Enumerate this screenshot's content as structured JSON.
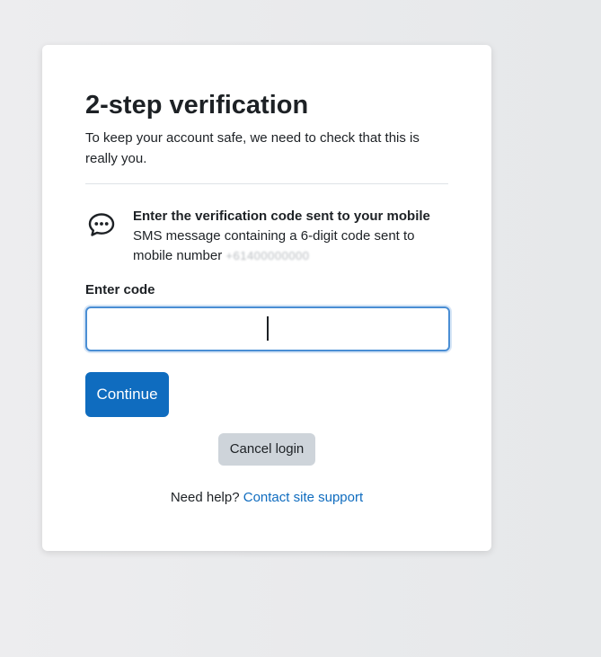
{
  "page": {
    "title": "2-step verification",
    "subtitle": "To keep your account safe, we need to check that this is really you."
  },
  "method": {
    "icon": "chat-bubble-icon",
    "heading": "Enter the verification code sent to your mobile",
    "detail_prefix": "SMS message containing a 6-digit code sent to mobile number",
    "masked_number": "+61400000000"
  },
  "form": {
    "code_label": "Enter code",
    "code_value": "",
    "continue_label": "Continue",
    "cancel_label": "Cancel login"
  },
  "help": {
    "prefix": "Need help?",
    "link_text": "Contact site support"
  },
  "colors": {
    "primary": "#0f6cbf",
    "focus_border": "#4a8ed4",
    "cancel_bg": "#ced4da",
    "text": "#1d2125"
  }
}
